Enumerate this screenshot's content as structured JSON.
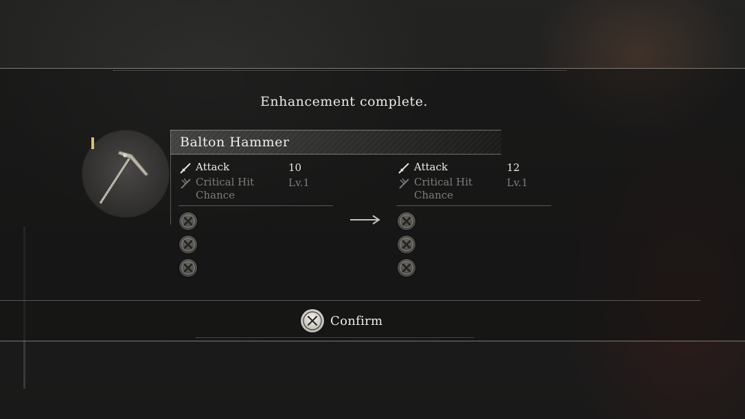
{
  "dialog": {
    "title": "Enhancement complete."
  },
  "item": {
    "name": "Balton Hammer",
    "image_icon": "war-hammer-icon",
    "rarity_color": "#d6c271"
  },
  "before": {
    "stats": [
      {
        "icon": "sword-icon",
        "label": "Attack",
        "value": "10",
        "active": true
      },
      {
        "icon": "critical-hit-icon",
        "label": "Critical Hit Chance",
        "value": "Lv.1",
        "active": false
      }
    ],
    "slots": [
      "empty-slot-icon",
      "empty-slot-icon",
      "empty-slot-icon"
    ]
  },
  "after": {
    "stats": [
      {
        "icon": "sword-icon",
        "label": "Attack",
        "value": "12",
        "active": true
      },
      {
        "icon": "critical-hit-icon",
        "label": "Critical Hit Chance",
        "value": "Lv.1",
        "active": false
      }
    ],
    "slots": [
      "empty-slot-icon",
      "empty-slot-icon",
      "empty-slot-icon"
    ]
  },
  "transition_icon": "right-arrow-icon",
  "footer": {
    "confirm_button_icon": "cross-button-icon",
    "confirm_label": "Confirm"
  }
}
